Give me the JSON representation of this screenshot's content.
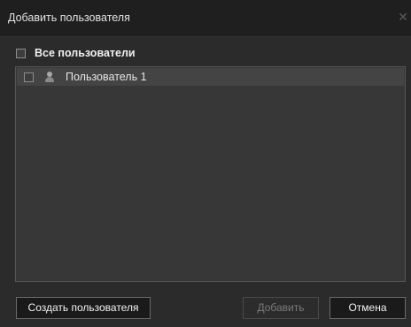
{
  "dialog": {
    "title": "Добавить пользователя",
    "close_icon": "close-icon"
  },
  "select_all": {
    "label": "Все пользователи",
    "checked": false
  },
  "users": [
    {
      "label": "Пользователь 1",
      "checked": false,
      "icon": "user-icon"
    }
  ],
  "buttons": {
    "create_label": "Создать пользователя",
    "add_label": "Добавить",
    "add_disabled": true,
    "cancel_label": "Отмена"
  },
  "colors": {
    "background": "#2b2b2b",
    "titlebar": "#1f1f1f",
    "list_background": "#373737",
    "selected_row": "#444444"
  }
}
